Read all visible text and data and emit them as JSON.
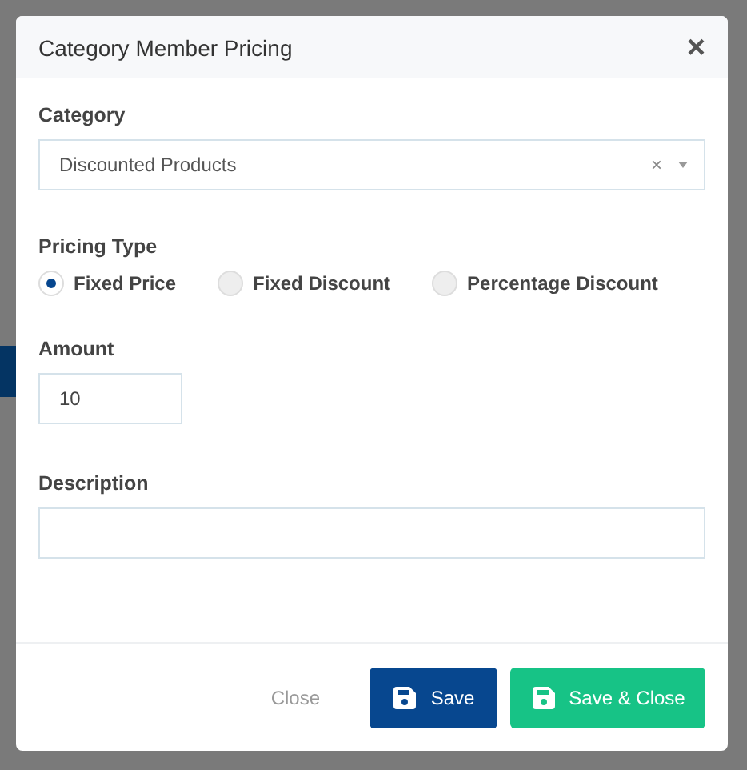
{
  "dialog": {
    "title": "Category Member Pricing",
    "close_icon": "×",
    "category": {
      "label": "Category",
      "value": "Discounted Products",
      "clear": "×"
    },
    "pricing_type": {
      "label": "Pricing Type",
      "options": [
        {
          "label": "Fixed Price",
          "selected": true
        },
        {
          "label": "Fixed Discount",
          "selected": false
        },
        {
          "label": "Percentage Discount",
          "selected": false
        }
      ]
    },
    "amount": {
      "label": "Amount",
      "value": "10"
    },
    "description": {
      "label": "Description"
    },
    "footer": {
      "close": "Close",
      "save": "Save",
      "save_close": "Save & Close"
    }
  }
}
